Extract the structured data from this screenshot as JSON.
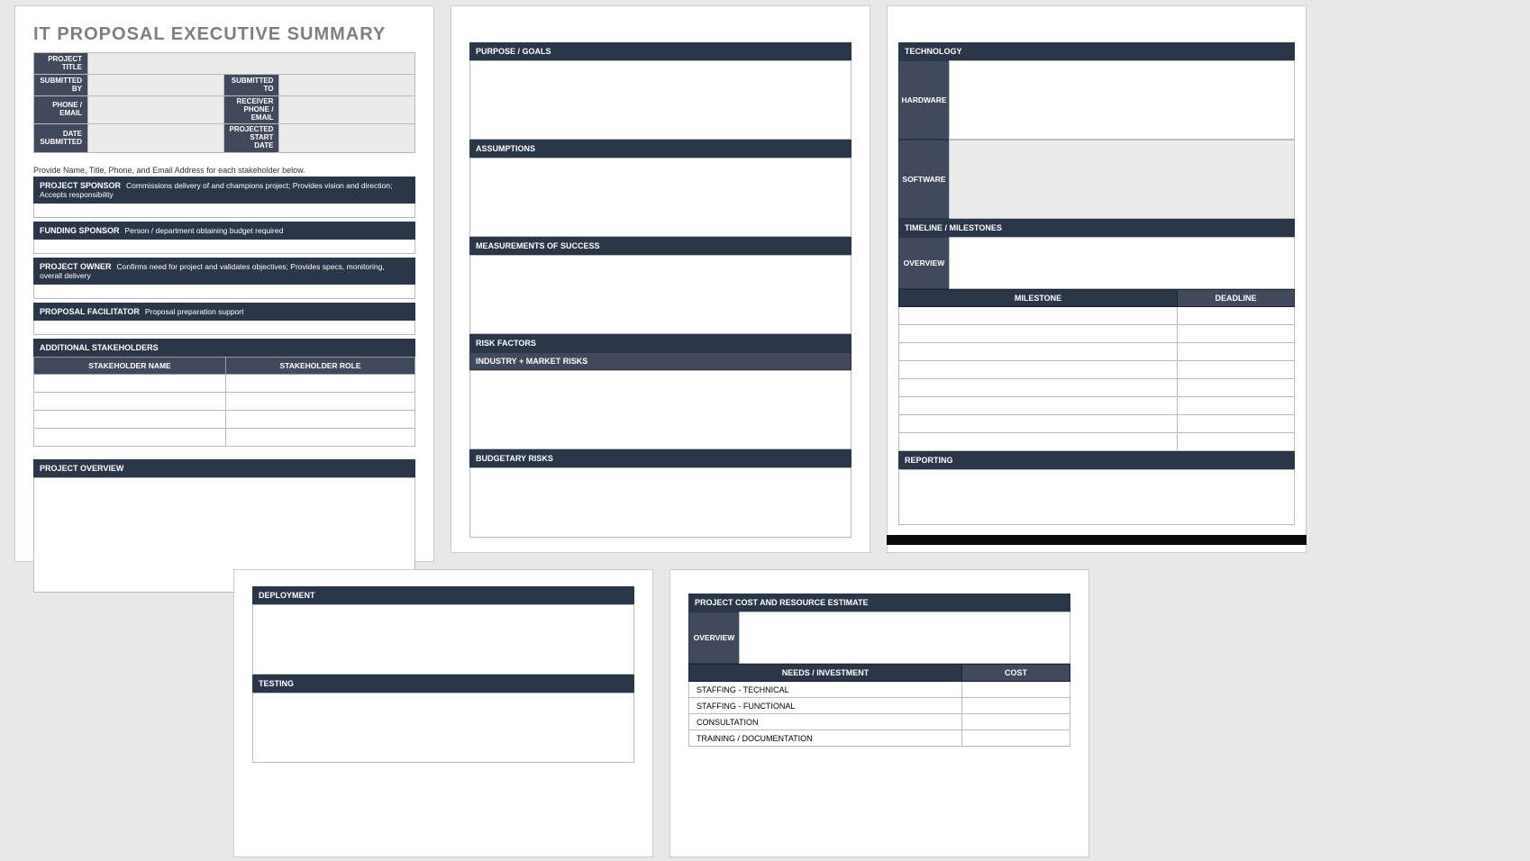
{
  "page1": {
    "title": "IT PROPOSAL EXECUTIVE SUMMARY",
    "meta": {
      "project_title": "PROJECT TITLE",
      "submitted_by": "SUBMITTED BY",
      "submitted_to": "SUBMITTED TO",
      "phone_email": "PHONE / EMAIL",
      "receiver_phone_email": "RECEIVER PHONE / EMAIL",
      "date_submitted": "DATE SUBMITTED",
      "projected_start_date": "PROJECTED START DATE"
    },
    "note": "Provide Name, Title, Phone, and Email Address for each stakeholder below.",
    "roles": {
      "project_sponsor": {
        "label": "PROJECT SPONSOR",
        "desc": "Commissions delivery of and champions project; Provides vision and direction; Accepts responsibility"
      },
      "funding_sponsor": {
        "label": "FUNDING SPONSOR",
        "desc": "Person / department obtaining budget required"
      },
      "project_owner": {
        "label": "PROJECT OWNER",
        "desc": "Confirms need for project and validates objectives; Provides specs, monitoring, overall delivery"
      },
      "proposal_facilitator": {
        "label": "PROPOSAL FACILITATOR",
        "desc": "Proposal preparation support"
      }
    },
    "stakeholders": {
      "header": "ADDITIONAL STAKEHOLDERS",
      "cols": {
        "name": "STAKEHOLDER NAME",
        "role": "STAKEHOLDER ROLE"
      }
    },
    "project_overview": "PROJECT OVERVIEW"
  },
  "page2": {
    "purpose_goals": "PURPOSE / GOALS",
    "assumptions": "ASSUMPTIONS",
    "measurements": "MEASUREMENTS OF SUCCESS",
    "risk_factors": "RISK FACTORS",
    "industry_risks": "INDUSTRY + MARKET RISKS",
    "budgetary_risks": "BUDGETARY RISKS"
  },
  "page3": {
    "technology": "TECHNOLOGY",
    "hardware": "HARDWARE",
    "software": "SOFTWARE",
    "timeline": "TIMELINE / MILESTONES",
    "overview": "OVERVIEW",
    "milestone_cols": {
      "milestone": "MILESTONE",
      "deadline": "DEADLINE"
    },
    "reporting": "REPORTING"
  },
  "page4": {
    "deployment": "DEPLOYMENT",
    "testing": "TESTING"
  },
  "page5": {
    "heading": "PROJECT COST AND RESOURCE ESTIMATE",
    "overview": "OVERVIEW",
    "cols": {
      "needs": "NEEDS / INVESTMENT",
      "cost": "COST"
    },
    "rows": [
      "STAFFING - TECHNICAL",
      "STAFFING - FUNCTIONAL",
      "CONSULTATION",
      "TRAINING / DOCUMENTATION"
    ]
  }
}
